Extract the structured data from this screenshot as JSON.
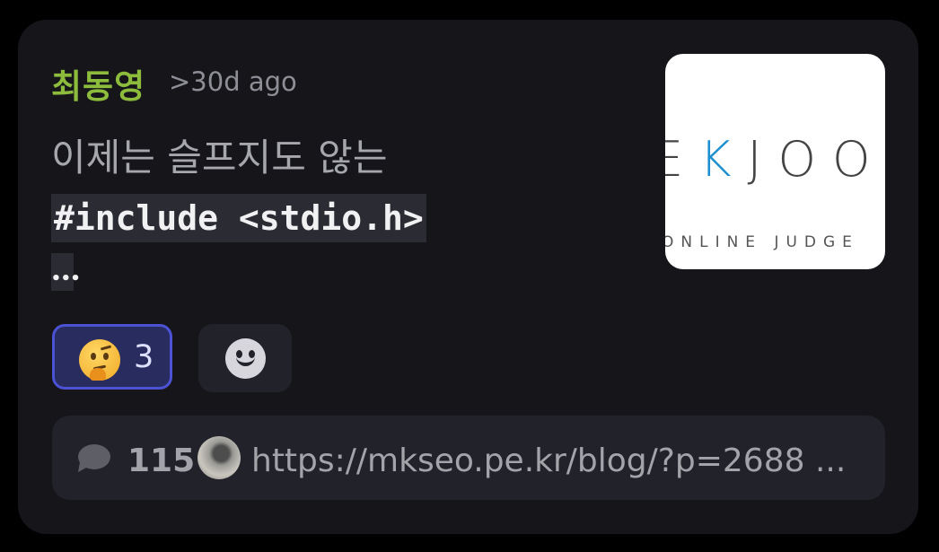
{
  "post": {
    "author": "최동영",
    "time": ">30d ago",
    "title": "이제는 슬프지도 않는",
    "code_line": "#include <stdio.h>",
    "code_more": "..."
  },
  "thumbnail": {
    "logo_text_1": "E",
    "logo_text_k": "K",
    "logo_text_2": "JOO",
    "logo_sub": "ONLINE JUDGE"
  },
  "reactions": [
    {
      "emoji": "thinking-face-icon",
      "count": "3",
      "selected": true
    }
  ],
  "add_reaction": {
    "icon": "smiley-face-icon"
  },
  "footer": {
    "comment_icon": "chat-bubble-icon",
    "comment_count": "115",
    "url": "https://mkseo.pe.kr/blog/?p=2688 ..."
  },
  "colors": {
    "author": "#8dbb3c",
    "reaction_border": "#4b52d4",
    "card_bg": "#15151a"
  }
}
